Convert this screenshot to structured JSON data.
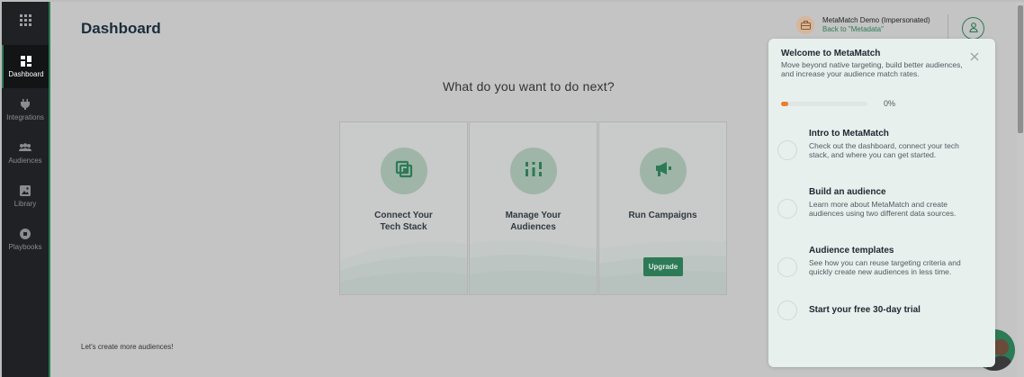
{
  "sidebar": {
    "items": [
      {
        "label": "Dashboard",
        "icon": "dashboard-icon",
        "active": true
      },
      {
        "label": "Integrations",
        "icon": "plug-icon",
        "active": false
      },
      {
        "label": "Audiences",
        "icon": "people-icon",
        "active": false
      },
      {
        "label": "Library",
        "icon": "image-icon",
        "active": false
      },
      {
        "label": "Playbooks",
        "icon": "playbook-icon",
        "active": false
      }
    ]
  },
  "header": {
    "title": "Dashboard",
    "account_name": "MetaMatch Demo (Impersonated)",
    "back_link": "Back to \"Metadata\""
  },
  "main": {
    "question": "What do you want to do next?",
    "cards": [
      {
        "label": "Connect Your Tech Stack",
        "icon": "stack-icon"
      },
      {
        "label": "Manage Your Audiences",
        "icon": "sliders-icon"
      },
      {
        "label": "Run Campaigns",
        "icon": "megaphone-icon",
        "button": "Upgrade"
      }
    ],
    "footer_text": "Let's create more audiences!"
  },
  "panel": {
    "title": "Welcome to MetaMatch",
    "description": "Move beyond native targeting, build better audiences, and increase your audience match rates.",
    "progress_label": "0%",
    "progress_value": 0,
    "steps": [
      {
        "title": "Intro to MetaMatch",
        "desc": "Check out the dashboard, connect your tech stack, and where you can get started."
      },
      {
        "title": "Build an audience",
        "desc": "Learn more about MetaMatch and create audiences using two different data sources."
      },
      {
        "title": "Audience templates",
        "desc": "See how you can reuse targeting criteria and quickly create new audiences in less time."
      },
      {
        "title": "Start your free 30-day trial",
        "desc": ""
      }
    ]
  },
  "colors": {
    "brand_green": "#2d7a56",
    "progress_orange": "#ee7c2a",
    "sidebar_bg": "#1f2124"
  }
}
